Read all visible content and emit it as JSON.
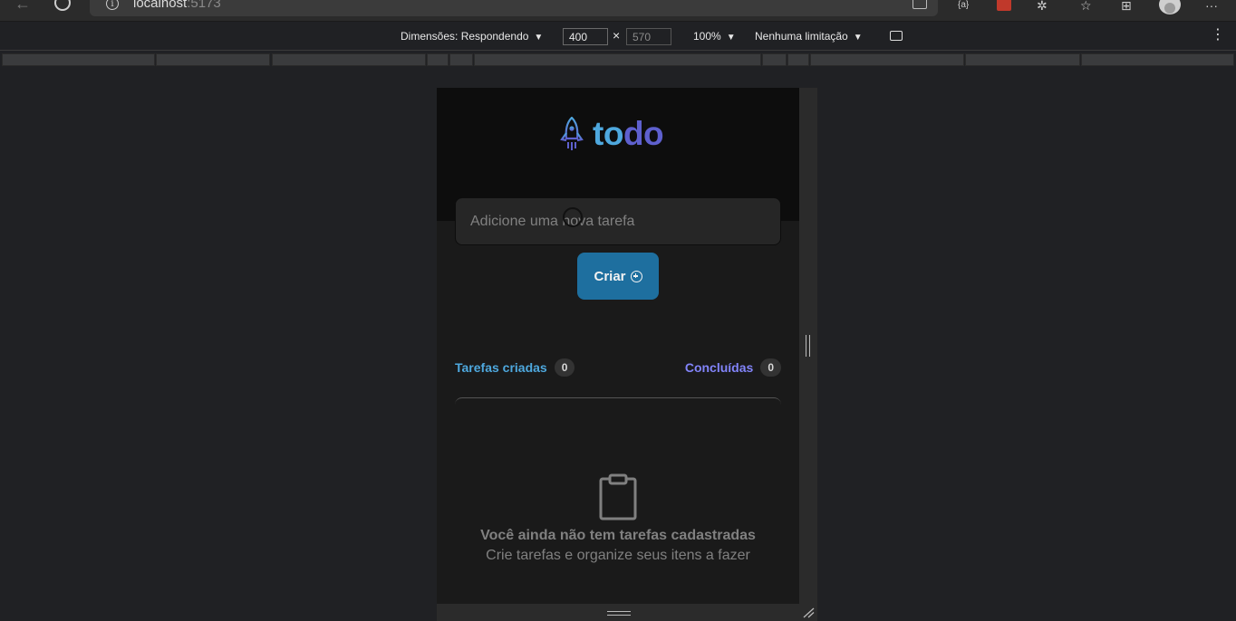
{
  "browser": {
    "url_host": "localhost",
    "url_port": ":5173"
  },
  "device_toolbar": {
    "dimensions_label": "Dimensões: Respondendo",
    "width": "400",
    "height": "570",
    "times": "×",
    "zoom": "100%",
    "throttling": "Nenhuma limitação"
  },
  "app": {
    "logo_to": "to",
    "logo_do": "do",
    "input_placeholder": "Adicione uma nova tarefa",
    "create_label": "Criar",
    "created_label": "Tarefas criadas",
    "created_count": "0",
    "done_label": "Concluídas",
    "done_count": "0",
    "empty_title": "Você ainda não tem tarefas cadastradas",
    "empty_subtitle": "Crie tarefas e organize seus itens a fazer"
  },
  "colors": {
    "brand_blue": "#4ea8de",
    "brand_purple": "#5e60ce",
    "button": "#1e6f9f"
  }
}
